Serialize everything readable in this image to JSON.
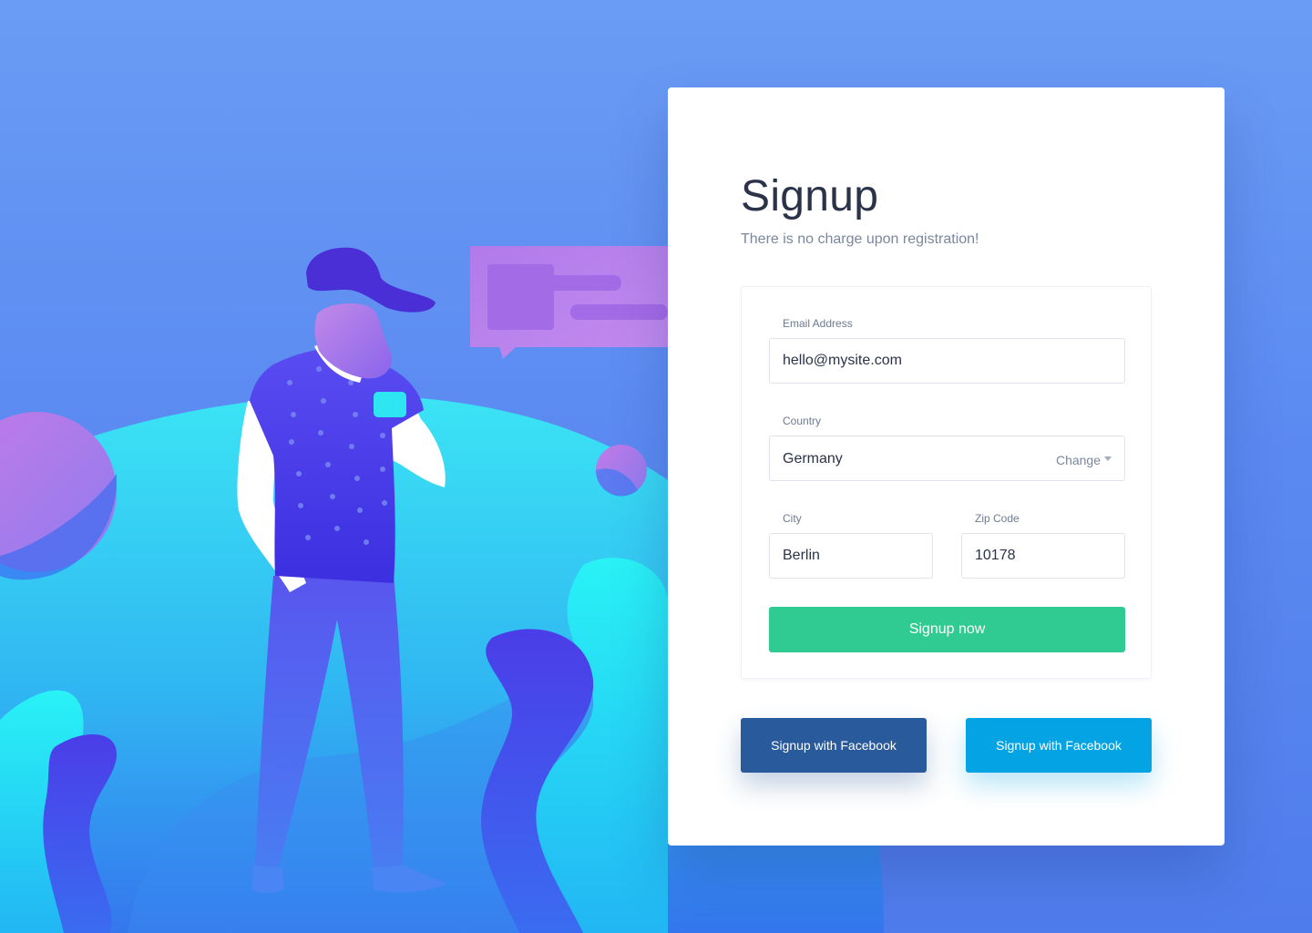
{
  "signup": {
    "title": "Signup",
    "subtitle": "There is no charge upon registration!"
  },
  "form": {
    "email": {
      "label": "Email Address",
      "value": "hello@mysite.com"
    },
    "country": {
      "label": "Country",
      "value": "Germany",
      "change_label": "Change"
    },
    "city": {
      "label": "City",
      "value": "Berlin"
    },
    "zip": {
      "label": "Zip Code",
      "value": "10178"
    },
    "submit_label": "Signup now"
  },
  "social": {
    "primary_label": "Signup with Facebook",
    "secondary_label": "Signup with Facebook"
  },
  "colors": {
    "background": "#5b8bf1",
    "submit": "#2fcb93",
    "facebook_dark": "#285a9c",
    "facebook_light": "#04a4e4",
    "title_text": "#2b3348"
  }
}
